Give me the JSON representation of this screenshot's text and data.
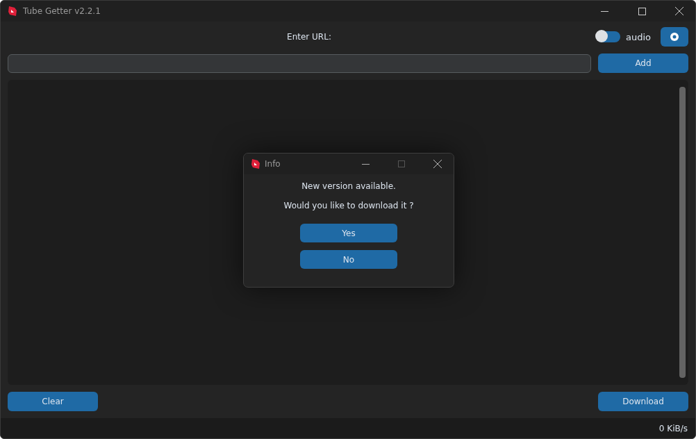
{
  "window": {
    "title": "Tube Getter v2.2.1"
  },
  "url_label": "Enter URL:",
  "audio_switch": {
    "label": "audio",
    "on": false
  },
  "add_button": "Add",
  "clear_button": "Clear",
  "download_button": "Download",
  "status_bar": {
    "speed": "0 KiB/s"
  },
  "dialog": {
    "title": "Info",
    "message": "New version available.",
    "question": "Would you like to download it ?",
    "buttons": [
      "Yes",
      "No"
    ]
  }
}
